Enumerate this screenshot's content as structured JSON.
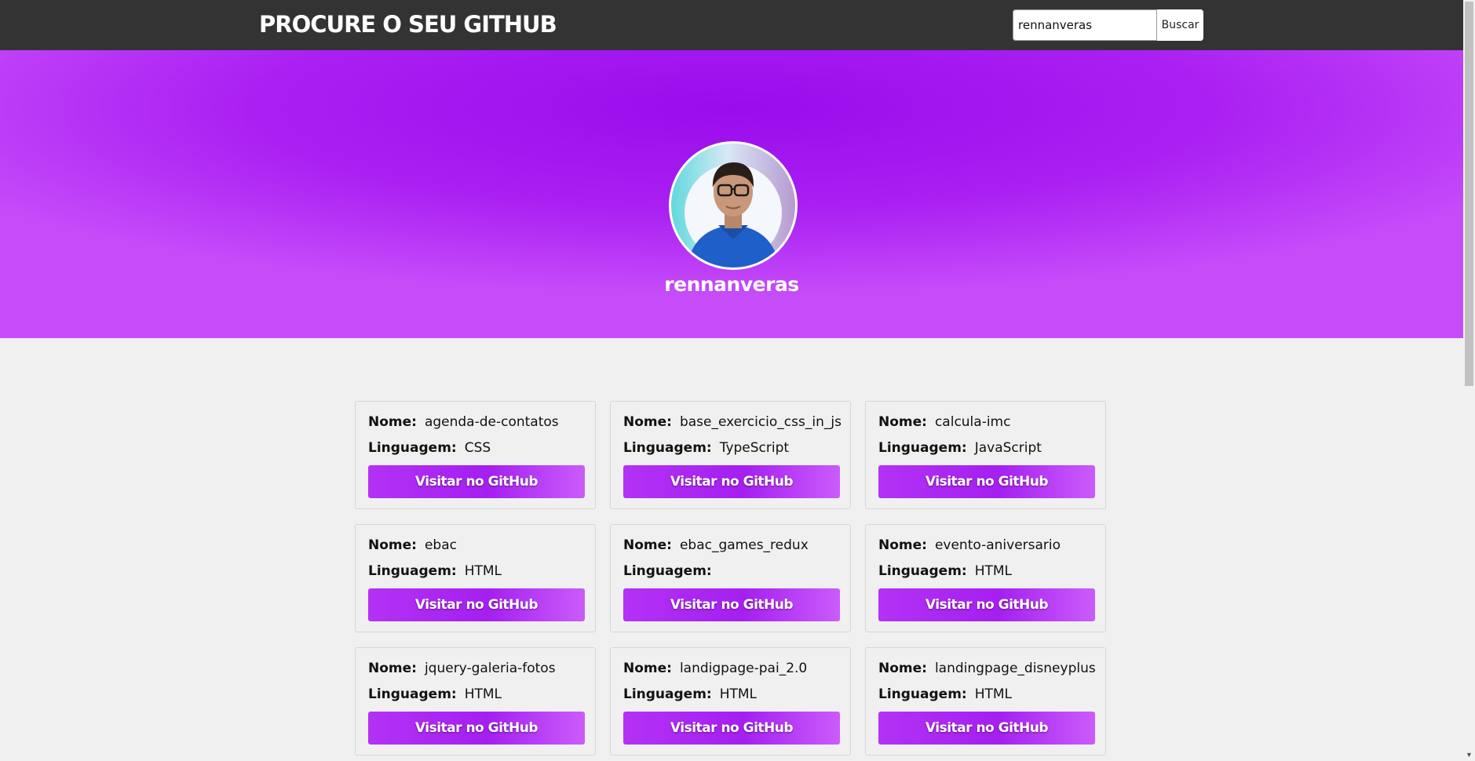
{
  "header": {
    "title": "PROCURE O SEU GITHUB",
    "search": {
      "value": "rennanveras",
      "button_label": "Buscar"
    }
  },
  "profile": {
    "username": "rennanveras",
    "avatar_icon": "user-photo"
  },
  "labels": {
    "name": "Nome:",
    "language": "Linguagem:"
  },
  "repos": [
    {
      "name": "agenda-de-contatos",
      "language": "CSS",
      "button": "Visitar no GitHub"
    },
    {
      "name": "base_exercicio_css_in_js",
      "language": "TypeScript",
      "button": "Visitar no GitHub"
    },
    {
      "name": "calcula-imc",
      "language": "JavaScript",
      "button": "Visitar no GitHub"
    },
    {
      "name": "ebac",
      "language": "HTML",
      "button": "Visitar no GitHub"
    },
    {
      "name": "ebac_games_redux",
      "language": "",
      "button": "Visitar no GitHub"
    },
    {
      "name": "evento-aniversario",
      "language": "HTML",
      "button": "Visitar no GitHub"
    },
    {
      "name": "jquery-galeria-fotos",
      "language": "HTML",
      "button": "Visitar no GitHub"
    },
    {
      "name": "landigpage-pai_2.0",
      "language": "HTML",
      "button": "Visitar no GitHub"
    },
    {
      "name": "landingpage_disneyplus",
      "language": "HTML",
      "button": "Visitar no GitHub"
    }
  ],
  "colors": {
    "topbar": "#333333",
    "accent": "#a51ff0",
    "hero": "#9a0cec",
    "page_background": "#f0f0f0"
  }
}
